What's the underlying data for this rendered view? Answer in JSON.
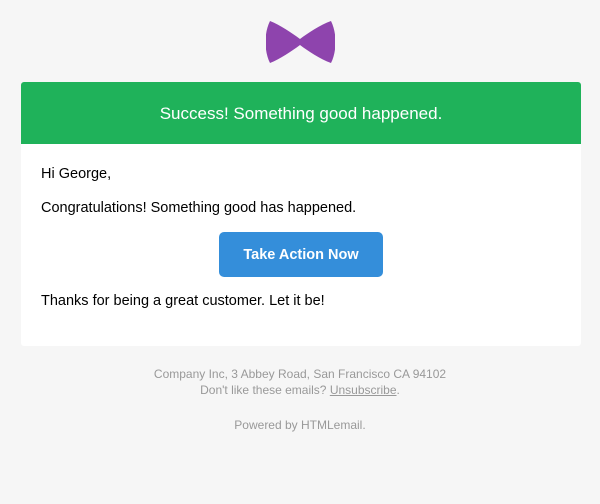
{
  "logo": {
    "icon": "bowtie-icon",
    "color": "#8e44ad"
  },
  "alert": {
    "text": "Success! Something good happened.",
    "color": "#1fb25a"
  },
  "body": {
    "greeting": "Hi George,",
    "message": "Congratulations! Something good has happened.",
    "cta_label": "Take Action Now",
    "cta_color": "#348eda",
    "closing": "Thanks for being a great customer. Let it be!"
  },
  "footer": {
    "address": "Company Inc, 3 Abbey Road, San Francisco CA 94102",
    "unsubscribe_prefix": "Don't like these emails? ",
    "unsubscribe_link": "Unsubscribe",
    "unsubscribe_suffix": ".",
    "powered_by": "Powered by HTMLemail."
  }
}
